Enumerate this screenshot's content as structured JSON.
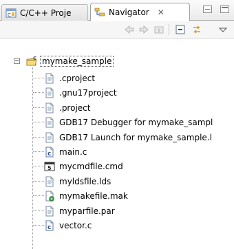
{
  "tabs": {
    "cpp_projects": {
      "label": "C/C++ Proje",
      "icon": "cpp-projects-icon"
    },
    "navigator": {
      "label": "Navigator",
      "icon": "navigator-icon",
      "close": "✕"
    }
  },
  "toolbar": {
    "buttons": [
      "back-arrow-icon",
      "forward-arrow-icon",
      "up-folder-icon",
      "collapse-all-icon",
      "link-with-editor-icon",
      "view-menu-icon"
    ]
  },
  "tree": {
    "project": {
      "label": "mymake_sample",
      "expanded": true
    },
    "items": [
      {
        "label": ".cproject",
        "icon": "text-file-icon"
      },
      {
        "label": ".gnu17project",
        "icon": "text-file-icon"
      },
      {
        "label": ".project",
        "icon": "text-file-icon"
      },
      {
        "label": "GDB17 Debugger for mymake_sampl",
        "icon": "text-file-icon"
      },
      {
        "label": "GDB17 Launch for mymake_sample.l",
        "icon": "text-file-icon"
      },
      {
        "label": "main.c",
        "icon": "c-source-file-icon"
      },
      {
        "label": "mycmdfile.cmd",
        "icon": "command-file-icon"
      },
      {
        "label": "myldsfile.lds",
        "icon": "text-file-icon"
      },
      {
        "label": "mymakefile.mak",
        "icon": "makefile-icon"
      },
      {
        "label": "myparfile.par",
        "icon": "text-file-icon"
      },
      {
        "label": "vector.c",
        "icon": "c-source-file-icon"
      }
    ]
  },
  "colors": {
    "accent": "#3b6fc4",
    "folder": "#e8c65a",
    "make_green": "#3aa34a"
  }
}
